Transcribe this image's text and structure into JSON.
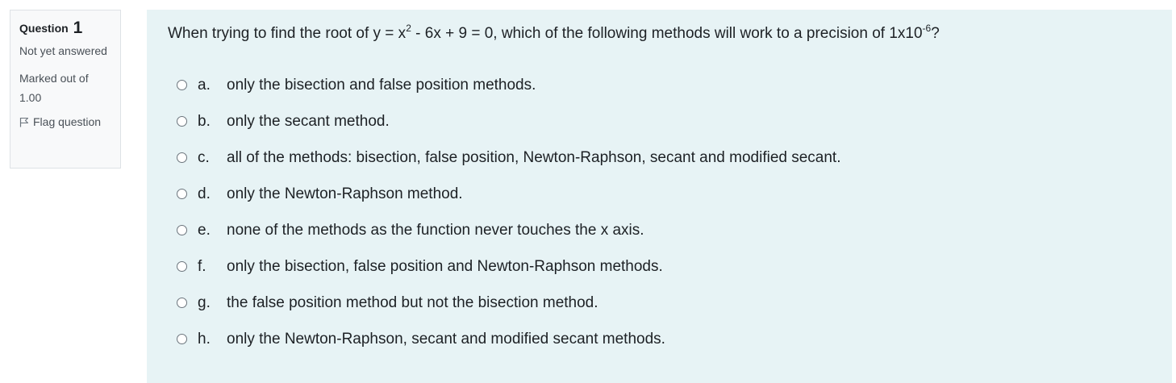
{
  "info": {
    "question_label": "Question",
    "question_number": "1",
    "state": "Not yet answered",
    "grade": "Marked out of 1.00",
    "flag_label": "Flag question"
  },
  "question": {
    "text_part1": "When trying to find the root of y = x",
    "sup1": "2",
    "text_part2": " - 6x + 9 = 0, which of the following methods will work to a precision of 1x10",
    "sup2": "-6",
    "text_part3": "?",
    "answers": [
      {
        "letter": "a.",
        "text": "only the bisection and false position methods."
      },
      {
        "letter": "b.",
        "text": "only the secant method."
      },
      {
        "letter": "c.",
        "text": "all of the methods: bisection, false position, Newton-Raphson, secant and modified secant."
      },
      {
        "letter": "d.",
        "text": "only the Newton-Raphson method."
      },
      {
        "letter": "e.",
        "text": "none of the methods as the function never touches the x axis."
      },
      {
        "letter": "f.",
        "text": "only the bisection, false position and Newton-Raphson methods."
      },
      {
        "letter": "g.",
        "text": "the false position method but not the bisection method."
      },
      {
        "letter": "h.",
        "text": "only the Newton-Raphson, secant and modified secant methods."
      }
    ]
  },
  "colors": {
    "info_bg": "#f8f9fa",
    "formulation_bg": "#e7f3f5",
    "border": "#dee2e6"
  }
}
